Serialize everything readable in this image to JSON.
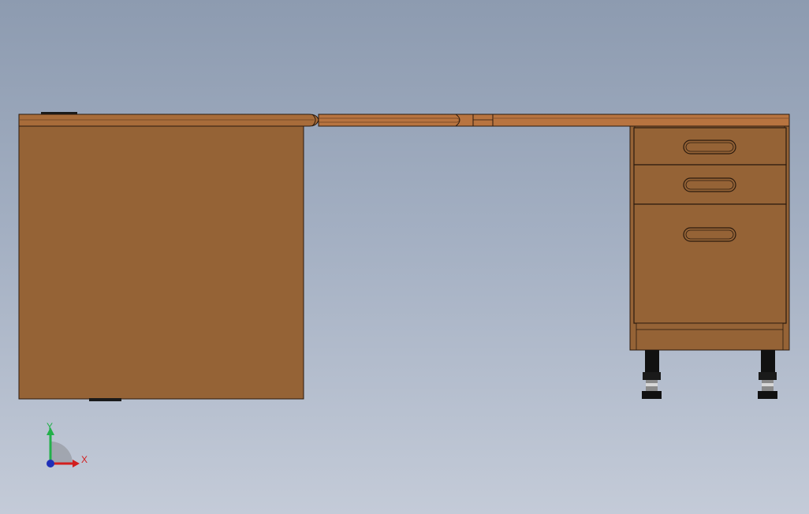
{
  "viewport": {
    "background_top": "#8d9bb0",
    "background_bottom": "#c4cbd8"
  },
  "model": {
    "wood_color": "#956336",
    "wood_edge_color": "#a86c3a",
    "outline_color": "#2a1a0e",
    "metal_color": "#1a1a1a"
  },
  "triad": {
    "x_label": "X",
    "y_label": "Y",
    "x_color": "#d21e1e",
    "y_color": "#22b04a",
    "z_color": "#1f2fb8"
  }
}
